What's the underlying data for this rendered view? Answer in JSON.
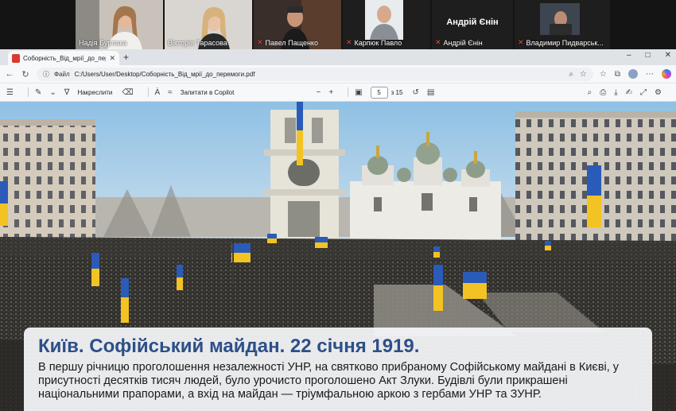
{
  "call": {
    "participants": [
      {
        "name": "Надія Бурлака",
        "muted": false,
        "speaking": true
      },
      {
        "name": "Вікторія Тарасова",
        "muted": false,
        "speaking": false
      },
      {
        "name": "Павел Пащенко",
        "muted": true,
        "speaking": false
      },
      {
        "name": "Карпюк Павло",
        "muted": true,
        "speaking": false
      },
      {
        "name": "Андрій Єнін",
        "muted": true,
        "speaking": false,
        "avatar_text": "Андрій Єнін"
      },
      {
        "name": "Владимир Пидварськ...",
        "muted": true,
        "speaking": false
      }
    ]
  },
  "browser": {
    "tab_title": "Соборність_Від_мрії_до_перемо",
    "address_label": "Файл",
    "url": "C:/Users/User/Desktop/Соборність_Від_мрії_до_перемоги.pdf"
  },
  "pdf_toolbar": {
    "draw_label": "Накреслити",
    "copilot_label": "Запитати в Copilot",
    "page_current": "5",
    "page_total": "з 15"
  },
  "slide": {
    "title": "Київ. Софійський майдан. 22 січня 1919.",
    "body": "В першу річницю проголошення незалежності УНР, на святково прибраному Софійському майдані в Києві, у присутності десятків тисяч людей, було урочисто проголошено Акт Злуки. Будівлі були прикрашені національними прапорами, а вхід на майдан — тріумфальною аркою з гербами УНР та ЗУНР."
  },
  "colors": {
    "title_blue": "#2d4f88",
    "flag_blue": "#2b5bb8",
    "flag_yellow": "#f3c323",
    "speaking_border": "#3ccf63",
    "mute_red": "#e5533d"
  }
}
